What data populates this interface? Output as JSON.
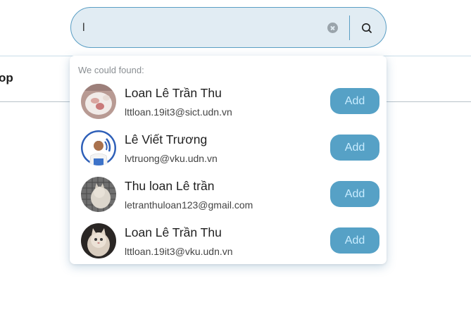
{
  "search": {
    "value": "l"
  },
  "background": {
    "partial_text": "op"
  },
  "dropdown": {
    "heading": "We could found:",
    "results": [
      {
        "name": "Loan Lê Trần Thu",
        "email": "lttloan.19it3@sict.udn.vn",
        "action": "Add",
        "avatar": "cat-avatar"
      },
      {
        "name": "Lê Viết Trương",
        "email": "lvtruong@vku.udn.vn",
        "action": "Add",
        "avatar": "man-avatar"
      },
      {
        "name": "Thu loan Lê trần",
        "email": "letranthuloan123@gmail.com",
        "action": "Add",
        "avatar": "cat-avatar"
      },
      {
        "name": "Loan Lê Trần Thu",
        "email": "lttloan.19it3@vku.udn.vn",
        "action": "Add",
        "avatar": "cat-avatar"
      }
    ]
  },
  "colors": {
    "accent": "#56a1c6",
    "search_bg": "#e1ecf3",
    "search_border": "#5a9ec4"
  }
}
